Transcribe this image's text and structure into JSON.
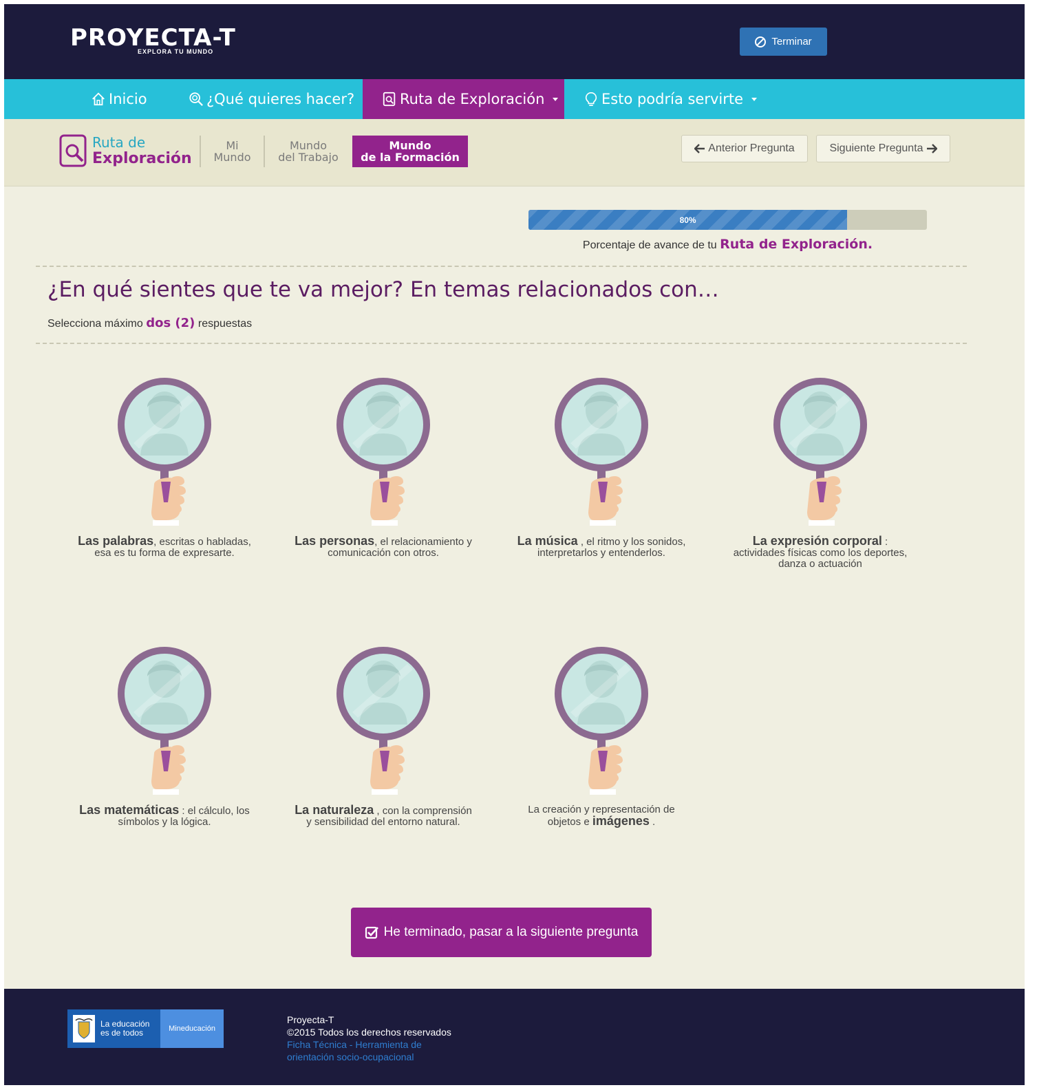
{
  "header": {
    "logo_title": "PROYECTA-T",
    "logo_subtitle": "EXPLORA TU MUNDO",
    "terminar_label": "Terminar"
  },
  "nav": {
    "inicio": "Inicio",
    "que_quieres": "¿Qué quieres hacer?",
    "ruta": "Ruta de Exploración",
    "esto_podria": "Esto podría servirte"
  },
  "subnav": {
    "ruta_line1": "Ruta de",
    "ruta_line2": "Exploración",
    "tabs": [
      {
        "line1": "Mi",
        "line2": "Mundo"
      },
      {
        "line1": "Mundo",
        "line2": "del Trabajo"
      },
      {
        "line1": "Mundo",
        "line2": "de la Formación"
      }
    ],
    "prev_label": "Anterior Pregunta",
    "next_label": "Siguiente Pregunta"
  },
  "progress": {
    "value": 80,
    "label": "80%",
    "caption_prefix": "Porcentaje de avance de tu",
    "caption_strong": "Ruta de Exploración."
  },
  "question": {
    "title": "¿En qué sientes que te va mejor? En temas relacionados con…",
    "instruction_prefix": "Selecciona máximo",
    "instruction_strong": "dos (2)",
    "instruction_suffix": "respuestas"
  },
  "options": [
    {
      "strong": "Las palabras",
      "rest": ", escritas o habladas, esa es tu forma de expresarte."
    },
    {
      "strong": "Las personas",
      "rest": ", el relacionamiento y comunicación con otros."
    },
    {
      "strong": "La música",
      "rest": " , el ritmo y los sonidos, interpretarlos y entenderlos."
    },
    {
      "strong": "La expresión corporal",
      "rest": " : actividades físicas como los deportes, danza o actuación"
    },
    {
      "strong": "Las matemáticas",
      "rest": " : el cálculo, los símbolos y la lógica."
    },
    {
      "strong": "La naturaleza",
      "rest": " , con la comprensión y sensibilidad del entorno natural."
    },
    {
      "prefix": "La creación y representación de objetos e ",
      "strong": "imágenes",
      "rest": " ."
    }
  ],
  "submit_label": "He terminado, pasar a la siguiente pregunta",
  "footer": {
    "logo_line1": "La educación",
    "logo_line2": "es de todos",
    "logo_ministry": "Mineducación",
    "line1": "Proyecta-T",
    "line2": "©2015 Todos los derechos reservados",
    "link_line1": "Ficha Técnica - Herramienta de",
    "link_line2": "orientación socio-ocupacional"
  },
  "colors": {
    "dark": "#1c1b3c",
    "cyan": "#27c0d9",
    "purple": "#92238c",
    "blue_button": "#2f72b4",
    "page_bg": "#f0efe1"
  }
}
